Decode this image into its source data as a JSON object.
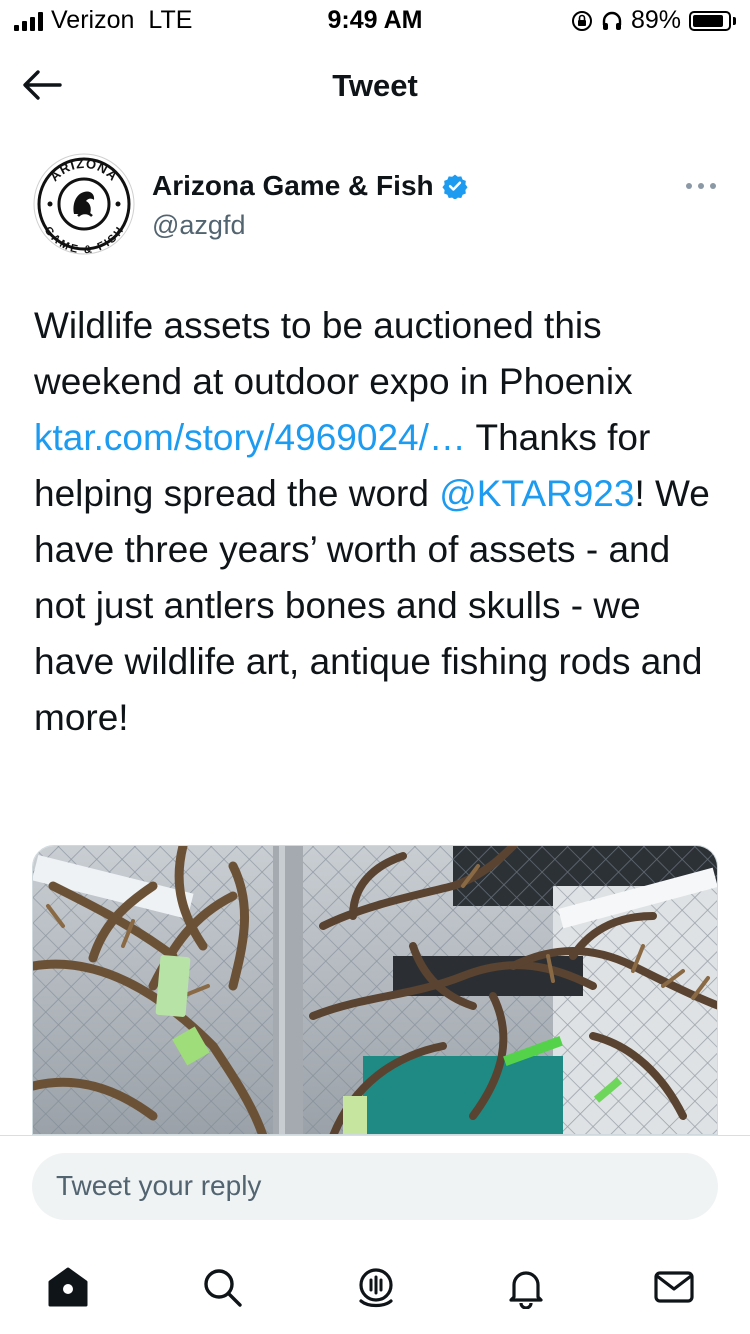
{
  "status_bar": {
    "carrier": "Verizon",
    "network": "LTE",
    "time": "9:49 AM",
    "battery": "89%",
    "battery_level": 0.89,
    "icons": [
      "signal-icon",
      "orientation-lock-icon",
      "headphones-icon",
      "battery-icon"
    ]
  },
  "header": {
    "title": "Tweet",
    "back_icon": "arrow-left-icon"
  },
  "tweet": {
    "author_name": "Arizona Game & Fish",
    "author_handle": "@azgfd",
    "avatar_text_top": "ARIZONA",
    "avatar_text_bottom": "GAME & FISH",
    "verified_icon": "verified-badge-icon",
    "more_icon": "more-options-icon",
    "text": {
      "part1": "Wildlife assets to be auctioned this weekend at outdoor expo in Phoenix ",
      "link": "ktar.com/story/4969024/…",
      "part2": " Thanks for helping spread the word ",
      "mention": "@KTAR923",
      "part3": "! We have three years’ worth of assets - and not just antlers bones and skulls - we have wildlife art, antique fishing rods and more!"
    },
    "colors": {
      "link": "#1d9bf0",
      "verified": "#1d9bf0"
    }
  },
  "reply": {
    "placeholder": "Tweet your reply"
  },
  "bottom_nav": {
    "items": [
      {
        "name": "home",
        "icon": "home-icon"
      },
      {
        "name": "search",
        "icon": "search-icon"
      },
      {
        "name": "spaces",
        "icon": "spaces-icon"
      },
      {
        "name": "notifications",
        "icon": "bell-icon"
      },
      {
        "name": "messages",
        "icon": "mail-icon"
      }
    ]
  }
}
